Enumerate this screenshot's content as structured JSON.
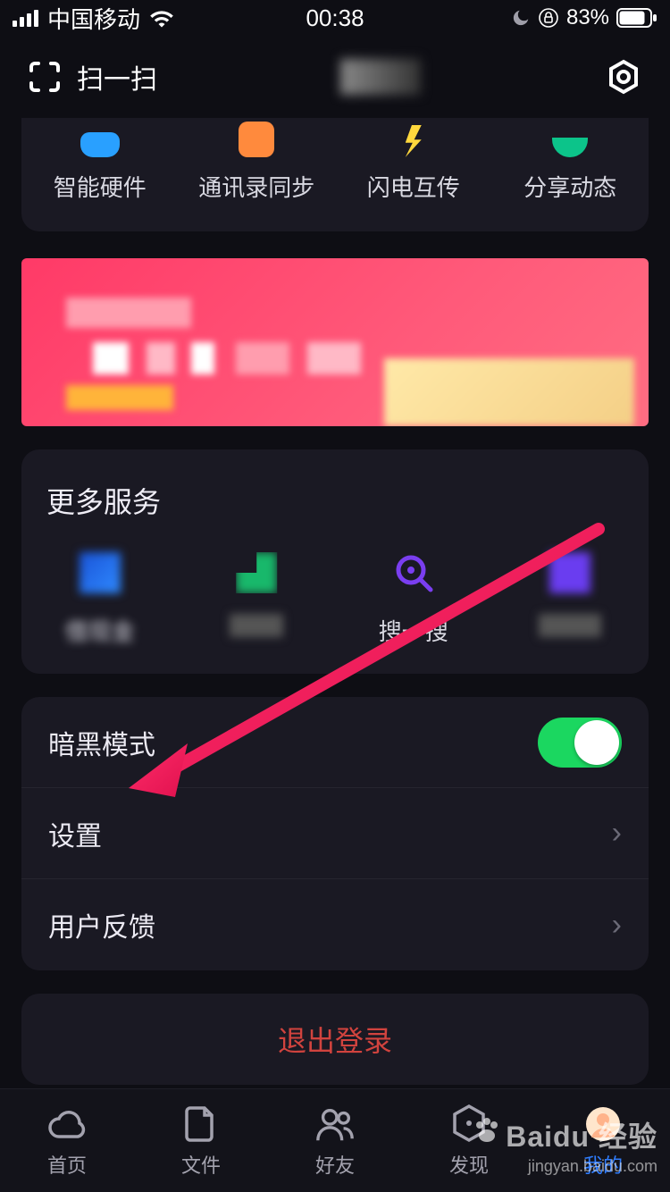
{
  "status": {
    "carrier": "中国移动",
    "time": "00:38",
    "battery_pct": "83%"
  },
  "header": {
    "scan_label": "扫一扫"
  },
  "shortcuts": {
    "items": [
      {
        "label": "智能硬件"
      },
      {
        "label": "通讯录同步"
      },
      {
        "label": "闪电互传"
      },
      {
        "label": "分享动态"
      }
    ]
  },
  "more_services": {
    "title": "更多服务",
    "items": [
      {
        "label": "借现金"
      },
      {
        "label": ""
      },
      {
        "label": "搜一搜"
      },
      {
        "label": ""
      }
    ]
  },
  "list": {
    "dark_mode_label": "暗黑模式",
    "dark_mode_on": true,
    "settings_label": "设置",
    "feedback_label": "用户反馈"
  },
  "logout_label": "退出登录",
  "bottom_nav": {
    "items": [
      {
        "label": "首页"
      },
      {
        "label": "文件"
      },
      {
        "label": "好友"
      },
      {
        "label": "发现"
      },
      {
        "label": "我的"
      }
    ],
    "active_index": 4
  },
  "watermark": {
    "brand": "Baidu 经验",
    "url": "jingyan.baidu.com"
  }
}
